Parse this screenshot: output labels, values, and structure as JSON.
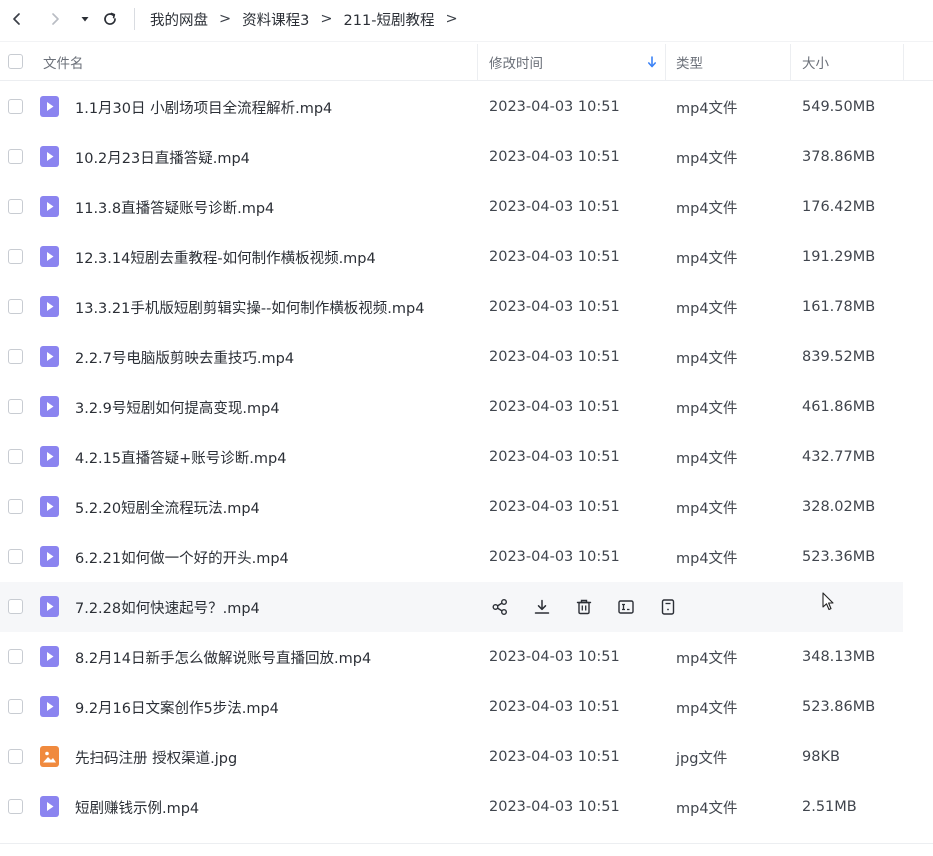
{
  "nav": {
    "back_icon": "chevron-left-icon",
    "forward_icon": "chevron-right-icon",
    "history_icon": "caret-down-icon",
    "refresh_icon": "refresh-icon"
  },
  "breadcrumb": {
    "items": [
      "我的网盘",
      "资料课程3",
      "211-短剧教程"
    ],
    "separator": ">"
  },
  "header": {
    "name": "文件名",
    "modified": "修改时间",
    "type": "类型",
    "size": "大小",
    "sort_icon": "arrow-down-icon"
  },
  "colors": {
    "video_icon": "#8b84f0",
    "image_icon": "#f08a3e",
    "sort_arrow": "#3b82f6"
  },
  "files": [
    {
      "name": "1.1月30日 小剧场项目全流程解析.mp4",
      "modified": "2023-04-03 10:51",
      "type": "mp4文件",
      "size": "549.50MB",
      "icon": "video-file-icon"
    },
    {
      "name": "10.2月23日直播答疑.mp4",
      "modified": "2023-04-03 10:51",
      "type": "mp4文件",
      "size": "378.86MB",
      "icon": "video-file-icon"
    },
    {
      "name": "11.3.8直播答疑账号诊断.mp4",
      "modified": "2023-04-03 10:51",
      "type": "mp4文件",
      "size": "176.42MB",
      "icon": "video-file-icon"
    },
    {
      "name": "12.3.14短剧去重教程-如何制作横板视频.mp4",
      "modified": "2023-04-03 10:51",
      "type": "mp4文件",
      "size": "191.29MB",
      "icon": "video-file-icon"
    },
    {
      "name": "13.3.21手机版短剧剪辑实操--如何制作横板视频.mp4",
      "modified": "2023-04-03 10:51",
      "type": "mp4文件",
      "size": "161.78MB",
      "icon": "video-file-icon"
    },
    {
      "name": "2.2.7号电脑版剪映去重技巧.mp4",
      "modified": "2023-04-03 10:51",
      "type": "mp4文件",
      "size": "839.52MB",
      "icon": "video-file-icon"
    },
    {
      "name": "3.2.9号短剧如何提高变现.mp4",
      "modified": "2023-04-03 10:51",
      "type": "mp4文件",
      "size": "461.86MB",
      "icon": "video-file-icon"
    },
    {
      "name": "4.2.15直播答疑+账号诊断.mp4",
      "modified": "2023-04-03 10:51",
      "type": "mp4文件",
      "size": "432.77MB",
      "icon": "video-file-icon"
    },
    {
      "name": "5.2.20短剧全流程玩法.mp4",
      "modified": "2023-04-03 10:51",
      "type": "mp4文件",
      "size": "328.02MB",
      "icon": "video-file-icon"
    },
    {
      "name": "6.2.21如何做一个好的开头.mp4",
      "modified": "2023-04-03 10:51",
      "type": "mp4文件",
      "size": "523.36MB",
      "icon": "video-file-icon"
    },
    {
      "name": "7.2.28如何快速起号？.mp4",
      "modified": "",
      "type": "",
      "size": "",
      "icon": "video-file-icon",
      "hovered": true
    },
    {
      "name": "8.2月14日新手怎么做解说账号直播回放.mp4",
      "modified": "2023-04-03 10:51",
      "type": "mp4文件",
      "size": "348.13MB",
      "icon": "video-file-icon"
    },
    {
      "name": "9.2月16日文案创作5步法.mp4",
      "modified": "2023-04-03 10:51",
      "type": "mp4文件",
      "size": "523.86MB",
      "icon": "video-file-icon"
    },
    {
      "name": "先扫码注册 授权渠道.jpg",
      "modified": "2023-04-03 10:51",
      "type": "jpg文件",
      "size": "98KB",
      "icon": "image-file-icon"
    },
    {
      "name": "短剧赚钱示例.mp4",
      "modified": "2023-04-03 10:51",
      "type": "mp4文件",
      "size": "2.51MB",
      "icon": "video-file-icon"
    }
  ],
  "hover_actions": [
    "share-icon",
    "download-icon",
    "delete-icon",
    "rename-icon",
    "details-icon"
  ]
}
